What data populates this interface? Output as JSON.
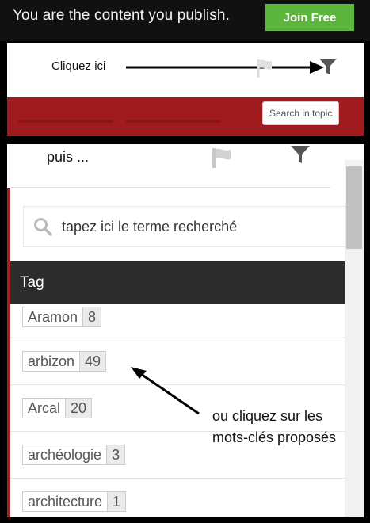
{
  "header": {
    "tagline": "You are the content you publish.",
    "join_label": "Join Free"
  },
  "panel_top": {
    "note": "Cliquez ici",
    "icons": [
      "flag-icon",
      "funnel-icon",
      "arrow-icon"
    ],
    "tooltip": "Search in topic",
    "band_color": "#9f1b1e"
  },
  "panel_bottom": {
    "note": "puis ...",
    "search": {
      "value": "tapez ici le terme recherché"
    },
    "tag_header": "Tag",
    "tags": [
      {
        "name": "Aramon",
        "count": "8"
      },
      {
        "name": "arbizon",
        "count": "49"
      },
      {
        "name": "Arcal",
        "count": "20"
      },
      {
        "name": "archéologie",
        "count": "3"
      },
      {
        "name": "architecture",
        "count": "1"
      }
    ],
    "callout_line1": "ou cliquez sur les",
    "callout_line2": "mots-clés proposés"
  },
  "colors": {
    "accent_green": "#5cb63e",
    "accent_red": "#a81d20",
    "header_dark": "#2c2c2c"
  }
}
